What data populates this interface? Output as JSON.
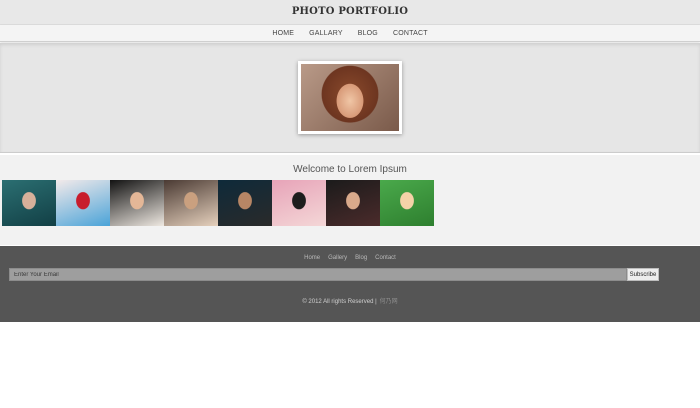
{
  "header": {
    "title": "PHOTO PORTFOLIO"
  },
  "nav": {
    "items": [
      "HOME",
      "GALLARY",
      "BLOG",
      "CONTACT"
    ]
  },
  "welcome": {
    "title": "Welcome to Lorem Ipsum"
  },
  "gallery": {
    "thumbs": [
      {
        "colors": [
          "#2b6f72",
          "#d7b09a",
          "#123f45"
        ]
      },
      {
        "colors": [
          "#f3eaea",
          "#c81d2d",
          "#4aa3d8"
        ]
      },
      {
        "colors": [
          "#121212",
          "#e4b797",
          "#efe9e2"
        ]
      },
      {
        "colors": [
          "#4a3a33",
          "#caa07f",
          "#e6d1bd"
        ]
      },
      {
        "colors": [
          "#0e2a3a",
          "#b78665",
          "#2a2a2a"
        ]
      },
      {
        "colors": [
          "#e7a3b8",
          "#1d1d1d",
          "#f4d7d7"
        ]
      },
      {
        "colors": [
          "#1b1b1b",
          "#d9a98b",
          "#4b2b2b"
        ]
      },
      {
        "colors": [
          "#4aa94b",
          "#f4d2a8",
          "#2e7f2f"
        ]
      }
    ]
  },
  "footer": {
    "links": [
      "Home",
      "Gallery",
      "Blog",
      "Contact"
    ],
    "email_placeholder": "Enter Your Email",
    "subscribe_label": "Subscribe",
    "copyright": "© 2012 All rights Reserved |",
    "credit": "何乃网"
  }
}
